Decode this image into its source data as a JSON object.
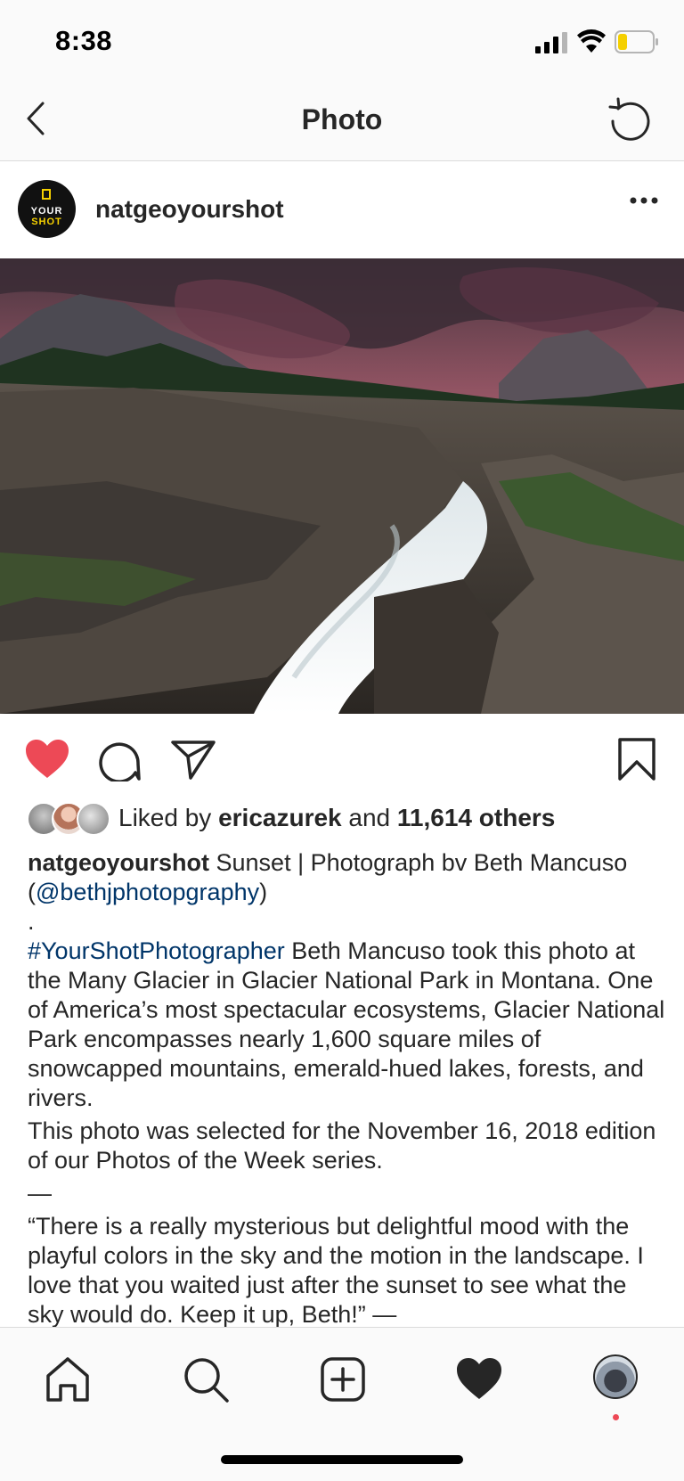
{
  "status_bar": {
    "time": "8:38"
  },
  "nav": {
    "title": "Photo"
  },
  "post": {
    "username": "natgeoyourshot",
    "avatar_text": {
      "line1": "YOUR",
      "line2": "SHOT"
    },
    "photo_alt": "Waterfall in Glacier National Park at sunset"
  },
  "likes": {
    "prefix": "Liked by ",
    "user": "ericazurek",
    "middle": " and ",
    "count": "11,614 others"
  },
  "caption": {
    "username": "natgeoyourshot",
    "title_text": " Sunset | Photograph bv Beth Mancuso (",
    "mention": "@bethjphotopgraphy",
    "title_end": ")",
    "dot": ".",
    "hashtag": "#YourShotPhotographer",
    "body": " Beth Mancuso took this photo at the Many Glacier in Glacier National Park in Montana. One of America’s most spectacular ecosystems, Glacier National Park encompasses nearly 1,600 square miles of snowcapped mountains, emerald-hued lakes, forests, and rivers.",
    "selected": "This photo was selected for the November 16, 2018 edition of our Photos of the Week series.",
    "dash": "—",
    "quote": "“There is a really mysterious but delightful mood with the playful colors in the sky and the motion in the landscape. I love that you waited just after the sunset to see what the sky would do. Keep it up, Beth!” —"
  },
  "colors": {
    "like_red": "#ed4956",
    "link_blue": "#003569",
    "text": "#262626",
    "bar_bg": "#fafafa"
  },
  "icons": {
    "back": "chevron-left-icon",
    "refresh": "refresh-icon",
    "more": "more-dots-icon",
    "like": "heart-filled-icon",
    "comment": "comment-icon",
    "share": "paper-plane-icon",
    "save": "bookmark-icon",
    "home": "home-icon",
    "search": "search-icon",
    "add": "add-post-icon",
    "activity": "heart-icon",
    "profile": "profile-avatar"
  }
}
